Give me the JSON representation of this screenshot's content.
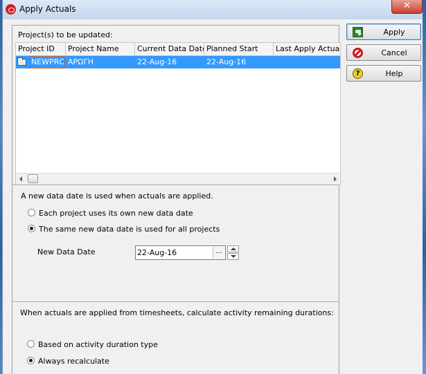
{
  "window": {
    "title": "Apply Actuals",
    "close_label": "✕"
  },
  "projects": {
    "caption": "Project(s) to be updated:",
    "columns": [
      "Project ID",
      "Project Name",
      "Current Data Date",
      "Planned Start",
      "Last Apply Actuals"
    ],
    "rows": [
      {
        "project_id": "NEWPROJ",
        "project_name": "ΑΡΩΓΗ",
        "current_data_date": "22-Aug-16",
        "planned_start": "22-Aug-16",
        "last_apply_actuals": ""
      }
    ]
  },
  "data_date": {
    "intro": "A new data date is used when actuals are applied.",
    "option_each": "Each project uses its own new data date",
    "option_same": "The same new data date is used for all projects",
    "selected": "same",
    "new_date_label": "New Data Date",
    "new_date_value": "22-Aug-16",
    "ellipsis": "..."
  },
  "durations": {
    "intro": "When actuals are applied from timesheets, calculate activity remaining durations:",
    "option_duration_type": "Based on activity duration type",
    "option_always": "Always recalculate",
    "selected": "always"
  },
  "buttons": {
    "apply": "Apply",
    "cancel": "Cancel",
    "help": "Help"
  },
  "icons": {
    "window": "oracle-logo-icon",
    "apply": "apply-icon",
    "cancel": "cancel-icon",
    "help": "help-icon",
    "row": "folder-icon"
  },
  "colors": {
    "selection": "#3399ff",
    "titlebar": "#c4d6ec",
    "close": "#c7402d"
  }
}
